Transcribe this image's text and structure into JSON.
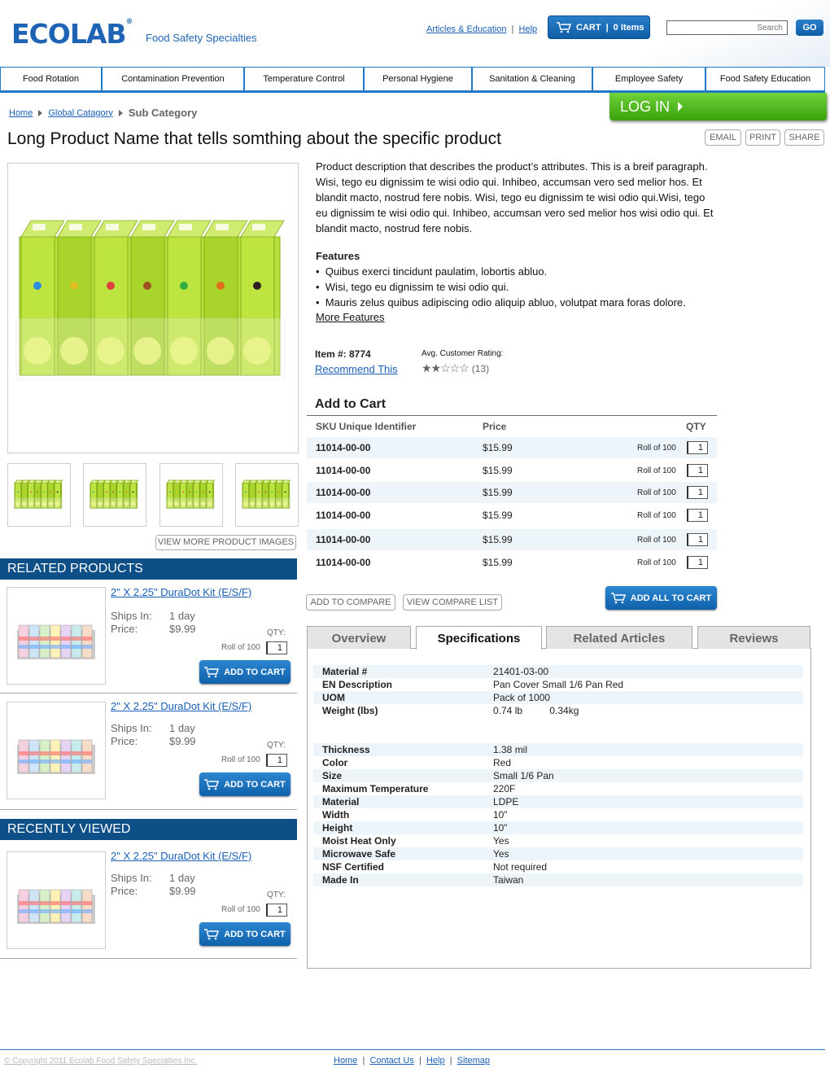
{
  "header": {
    "logo": "ECOLAB",
    "logo_reg": "®",
    "tagline": "Food Safety Specialties",
    "links": [
      "Articles & Education",
      "Help"
    ],
    "cart_label": "CART",
    "cart_items": "0 Items",
    "search_placeholder": "Search",
    "go_label": "GO"
  },
  "nav": [
    "Food Rotation",
    "Contamination Prevention",
    "Temperature Control",
    "Personal Hygiene",
    "Sanitation & Cleaning",
    "Employee Safety",
    "Food Safety Education"
  ],
  "breadcrumb": {
    "home": "Home",
    "global": "Global Catagory",
    "current": "Sub Category"
  },
  "login_label": "LOG IN",
  "product": {
    "title": "Long Product Name that tells somthing about the specific product",
    "actions": [
      "EMAIL",
      "PRINT",
      "SHARE"
    ],
    "description": "Product description that describes the product’s attributes. This is a breif paragraph. Wisi, tego eu dignissim te wisi odio qui. Inhibeo, accumsan vero sed melior hos. Et blandit macto, nostrud fere nobis. Wisi, tego eu dignissim te wisi odio qui.Wisi, tego eu dignissim te wisi odio qui. Inhibeo, accumsan vero sed melior hos wisi odio qui. Et blandit macto, nostrud fere nobis.",
    "features_heading": "Features",
    "features": [
      "Quibus exerci tincidunt paulatim, lobortis abluo.",
      "Wisi, tego eu dignissim te wisi odio qui.",
      "Mauris zelus quibus adipiscing odio aliquip abluo, volutpat mara foras dolore."
    ],
    "more_features": "More Features",
    "item_label": "Item #: 8774",
    "recommend": "Recommend This",
    "rating_label": "Avg. Customer Rating:",
    "rating_stars": 2,
    "rating_count": "(13)",
    "view_more_images": "VIEW MORE PRODUCT IMAGES"
  },
  "add_to_cart": {
    "heading": "Add to Cart",
    "headers": {
      "sku": "SKU Unique Identifier",
      "price": "Price",
      "qty": "QTY"
    },
    "rows": [
      {
        "sku": "11014-00-00",
        "price": "$15.99",
        "unit": "Roll of 100",
        "qty": "1"
      },
      {
        "sku": "11014-00-00",
        "price": "$15.99",
        "unit": "Roll of 100",
        "qty": "1"
      },
      {
        "sku": "11014-00-00",
        "price": "$15.99",
        "unit": "Roll of 100",
        "qty": "1"
      },
      {
        "sku": "11014-00-00",
        "price": "$15.99",
        "unit": "Roll of 100",
        "qty": "1"
      },
      {
        "sku": "11014-00-00",
        "price": "$15.99",
        "unit": "Roll of 100",
        "qty": "1"
      },
      {
        "sku": "11014-00-00",
        "price": "$15.99",
        "unit": "Roll of 100",
        "qty": "1"
      }
    ],
    "compare_label": "ADD TO COMPARE",
    "compare_list_label": "VIEW COMPARE LIST",
    "add_all_label": "ADD ALL TO CART"
  },
  "tabs": [
    "Overview",
    "Specifications",
    "Related Articles",
    "Reviews"
  ],
  "specs_group1": [
    {
      "k": "Material #",
      "v": "21401-03-00"
    },
    {
      "k": "EN Description",
      "v": "Pan Cover Small 1/6 Pan Red"
    },
    {
      "k": "UOM",
      "v": "Pack of 1000"
    },
    {
      "k": "Weight (lbs)",
      "v": "0.74 lb          0.34kg"
    }
  ],
  "specs_group2": [
    {
      "k": "Thickness",
      "v": "1.38 mil"
    },
    {
      "k": "Color",
      "v": "Red"
    },
    {
      "k": "Size",
      "v": "Small 1/6 Pan"
    },
    {
      "k": "Maximum Temperature",
      "v": "220F"
    },
    {
      "k": "Material",
      "v": "LDPE"
    },
    {
      "k": "Width",
      "v": "10”"
    },
    {
      "k": "Height",
      "v": "10”"
    },
    {
      "k": "Moist Heat Only",
      "v": "Yes"
    },
    {
      "k": "Microwave Safe",
      "v": "Yes"
    },
    {
      "k": "NSF Certified",
      "v": "Not required"
    },
    {
      "k": "Made In",
      "v": "Taiwan"
    }
  ],
  "related": {
    "heading": "RELATED PRODUCTS",
    "items": [
      {
        "title": "2\" X 2.25\" DuraDot Kit (E/S/F)",
        "ships_label": "Ships In:",
        "ships": "1 day",
        "price_label": "Price:",
        "price": "$9.99",
        "qty_label": "QTY:",
        "unit": "Roll of 100",
        "qty": "1",
        "btn": "ADD TO CART"
      },
      {
        "title": "2\" X 2.25\" DuraDot Kit (E/S/F)",
        "ships_label": "Ships In:",
        "ships": "1 day",
        "price_label": "Price:",
        "price": "$9.99",
        "qty_label": "QTY:",
        "unit": "Roll of 100",
        "qty": "1",
        "btn": "ADD TO CART"
      }
    ]
  },
  "recent": {
    "heading": "RECENTLY VIEWED",
    "items": [
      {
        "title": "2\" X 2.25\" DuraDot Kit (E/S/F)",
        "ships_label": "Ships In:",
        "ships": "1 day",
        "price_label": "Price:",
        "price": "$9.99",
        "qty_label": "QTY:",
        "unit": "Roll of 100",
        "qty": "1",
        "btn": "ADD TO CART"
      }
    ]
  },
  "footer": {
    "copyright": "© Copyright 2011 Ecolab Food Safety Specialties Inc.",
    "links": [
      "Home",
      "Contact Us",
      "Help",
      "Sitemap"
    ]
  },
  "colors": {
    "brand_blue": "#1f64b4",
    "nav_border": "#1f78c8",
    "section_header": "#0d4f86",
    "login_green": "#4cb81a",
    "row_shade": "#edf4fa"
  }
}
